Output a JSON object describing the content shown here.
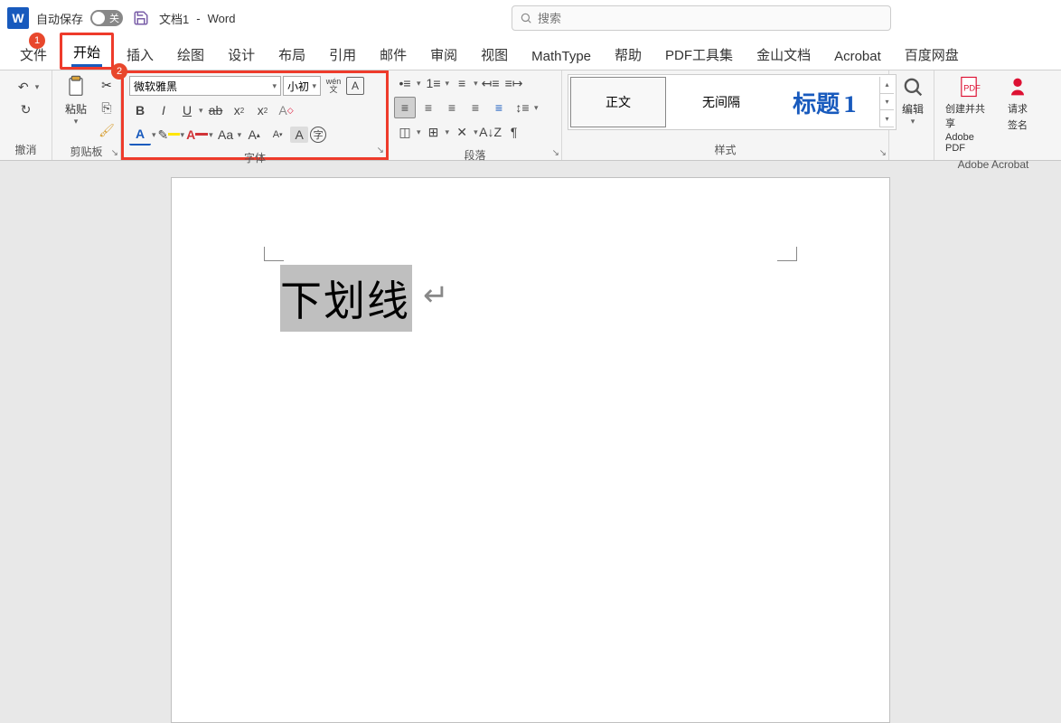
{
  "titlebar": {
    "autosave": "自动保存",
    "toggle_state": "关",
    "doc_name": "文档1",
    "separator": "-",
    "app_name": "Word",
    "search_placeholder": "搜索"
  },
  "tabs": [
    "文件",
    "开始",
    "插入",
    "绘图",
    "设计",
    "布局",
    "引用",
    "邮件",
    "审阅",
    "视图",
    "MathType",
    "帮助",
    "PDF工具集",
    "金山文档",
    "Acrobat",
    "百度网盘"
  ],
  "active_tab": 1,
  "badges": {
    "b1": "1",
    "b2": "2"
  },
  "ribbon": {
    "undo": {
      "label": "撤消"
    },
    "clipboard": {
      "paste": "粘贴",
      "label": "剪贴板"
    },
    "font": {
      "name": "微软雅黑",
      "size": "小初",
      "label": "字体",
      "change_case": "Aa"
    },
    "paragraph": {
      "label": "段落"
    },
    "styles": {
      "label": "样式",
      "items": [
        "正文",
        "无间隔",
        "标题 1"
      ]
    },
    "editing": {
      "label": "编辑"
    },
    "acrobat": {
      "create_share": "创建并共享",
      "adobe_pdf": "Adobe PDF",
      "request": "请求",
      "sign": "签名",
      "label": "Adobe Acrobat"
    }
  },
  "document": {
    "selected_text": "下划线"
  }
}
